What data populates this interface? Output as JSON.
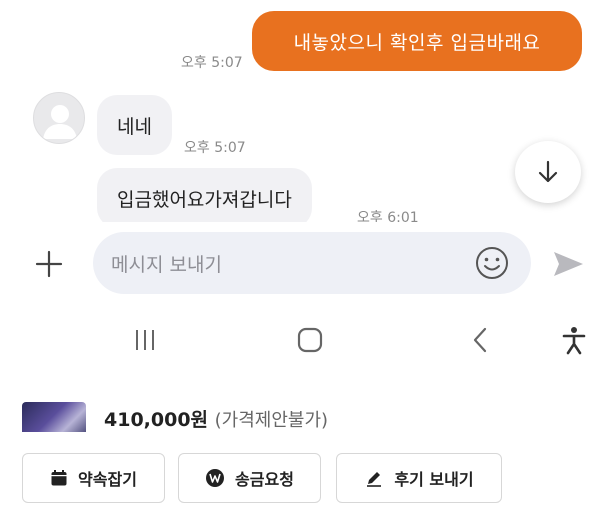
{
  "messages": [
    {
      "direction": "outgoing",
      "text": "내놓았으니 확인후 입금바래요",
      "time": "오후 5:07"
    },
    {
      "direction": "incoming",
      "text": "네네",
      "time": "오후 5:07"
    },
    {
      "direction": "incoming",
      "text": "입금했어요가져갑니다",
      "time": "오후 6:01"
    }
  ],
  "composer": {
    "placeholder": "메시지 보내기"
  },
  "product": {
    "price": "410,000원",
    "price_note": "(가격제안불가)"
  },
  "actions": [
    {
      "label": "약속잡기",
      "icon": "calendar-icon"
    },
    {
      "label": "송금요청",
      "icon": "won-coin-icon"
    },
    {
      "label": "후기 보내기",
      "icon": "pencil-icon"
    }
  ],
  "colors": {
    "accent": "#e8711f",
    "incoming_bubble": "#f1f1f4",
    "composer_bg": "#eef0f6"
  }
}
